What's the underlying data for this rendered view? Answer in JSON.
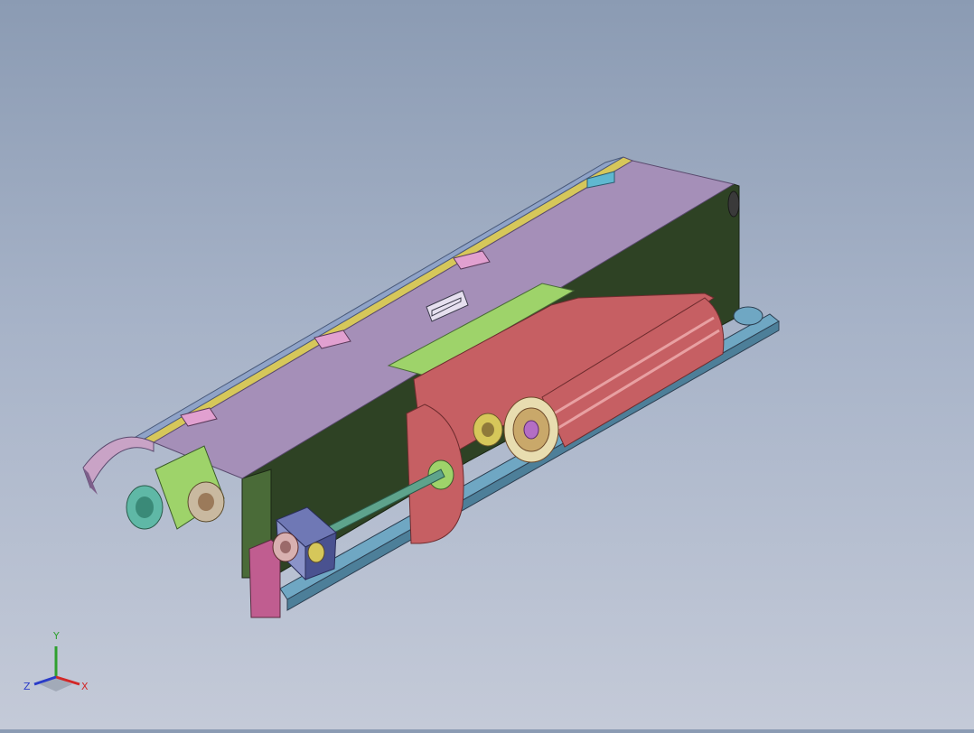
{
  "viewport": {
    "background_top": "#8b9bb3",
    "background_bottom": "#c4cad8"
  },
  "model": {
    "parts": [
      "hood-cover",
      "hood-hinge",
      "hood-handle",
      "side-panel",
      "drive-roller",
      "idler-pulley",
      "bearing-housing",
      "shaft",
      "gearbox",
      "motor-flange",
      "base-rail",
      "mount-bracket"
    ],
    "colors": {
      "hood": "#a58fb8",
      "hood_edge": "#7a6a8f",
      "side_panel": "#2e4224",
      "roller": "#c65f63",
      "roller_dark": "#9d4548",
      "shaft": "#5ea38c",
      "rail": "#6fa7c3",
      "gearbox": "#6f78b5",
      "flange": "#5fb8a6",
      "green_part": "#9ed36a",
      "bracket": "#c05d90",
      "trim": "#d6c75a"
    }
  },
  "triad": {
    "x_label": "X",
    "y_label": "Y",
    "z_label": "Z",
    "x_color": "#d22828",
    "y_color": "#2fa02f",
    "z_color": "#2a3cc8"
  }
}
